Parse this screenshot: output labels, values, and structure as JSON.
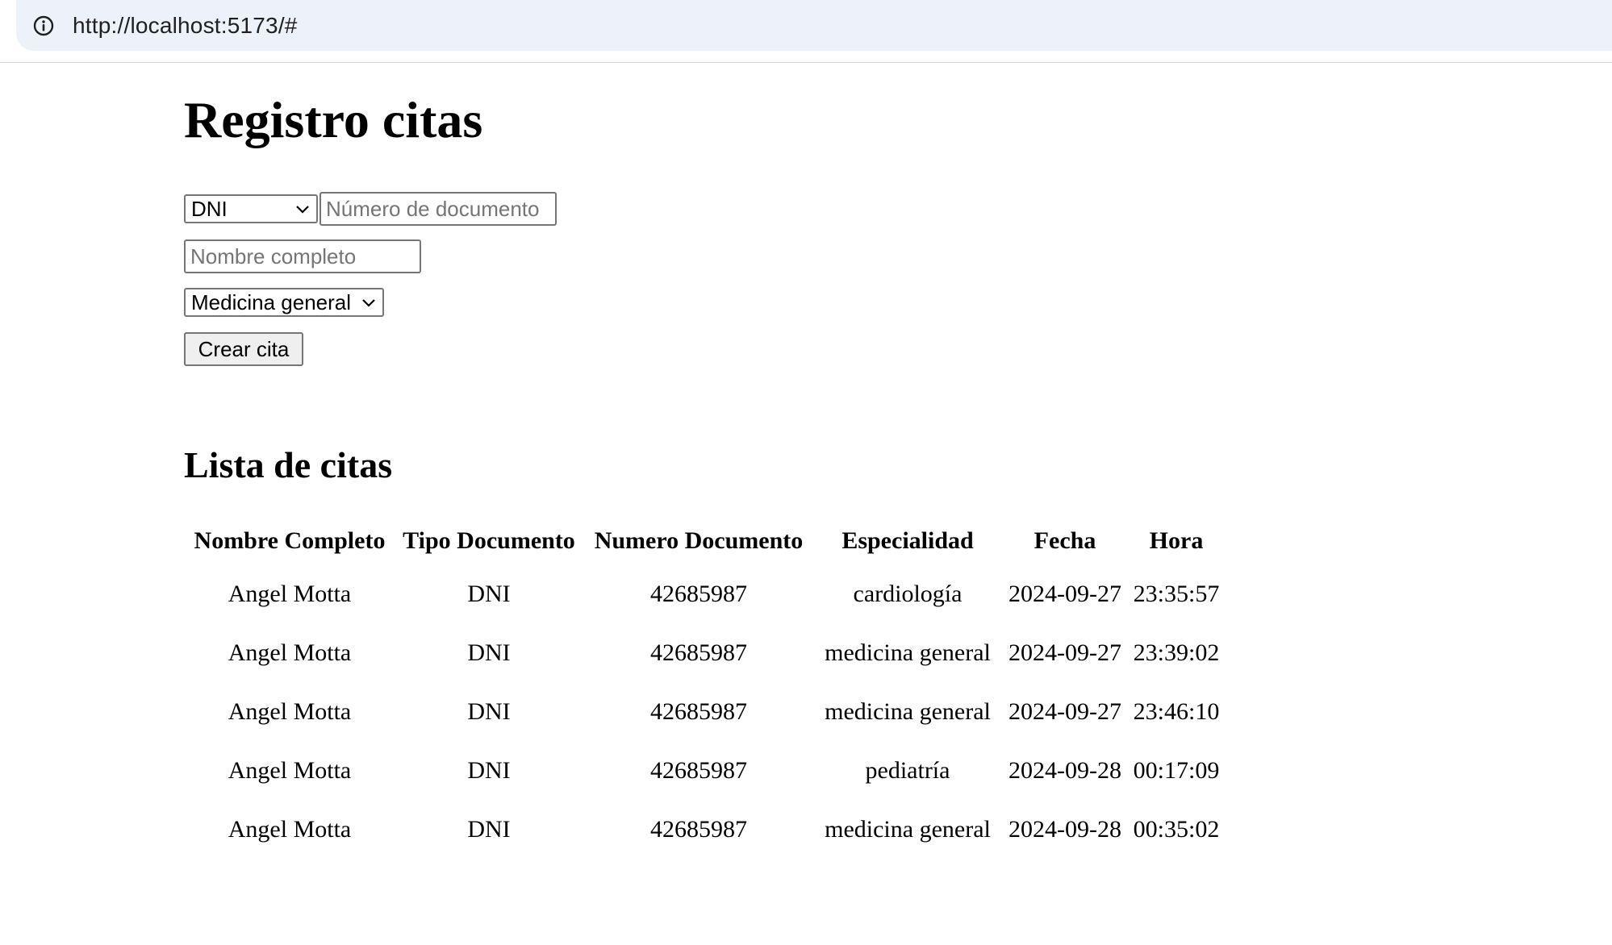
{
  "browser": {
    "url": "http://localhost:5173/#"
  },
  "page": {
    "title": "Registro citas",
    "form": {
      "doc_type_selected": "DNI",
      "doc_number_placeholder": "Número de documento",
      "full_name_placeholder": "Nombre completo",
      "specialty_selected": "Medicina general",
      "submit_label": "Crear cita"
    },
    "list_title": "Lista de citas",
    "table": {
      "headers": [
        "Nombre Completo",
        "Tipo Documento",
        "Numero Documento",
        "Especialidad",
        "Fecha",
        "Hora"
      ],
      "rows": [
        [
          "Angel Motta",
          "DNI",
          "42685987",
          "cardiología",
          "2024-09-27",
          "23:35:57"
        ],
        [
          "Angel Motta",
          "DNI",
          "42685987",
          "medicina general",
          "2024-09-27",
          "23:39:02"
        ],
        [
          "Angel Motta",
          "DNI",
          "42685987",
          "medicina general",
          "2024-09-27",
          "23:46:10"
        ],
        [
          "Angel Motta",
          "DNI",
          "42685987",
          "pediatría",
          "2024-09-28",
          "00:17:09"
        ],
        [
          "Angel Motta",
          "DNI",
          "42685987",
          "medicina general",
          "2024-09-28",
          "00:35:02"
        ]
      ]
    }
  },
  "icons": {
    "site_info": "info-icon",
    "select_arrow": "chevron-down-icon"
  }
}
